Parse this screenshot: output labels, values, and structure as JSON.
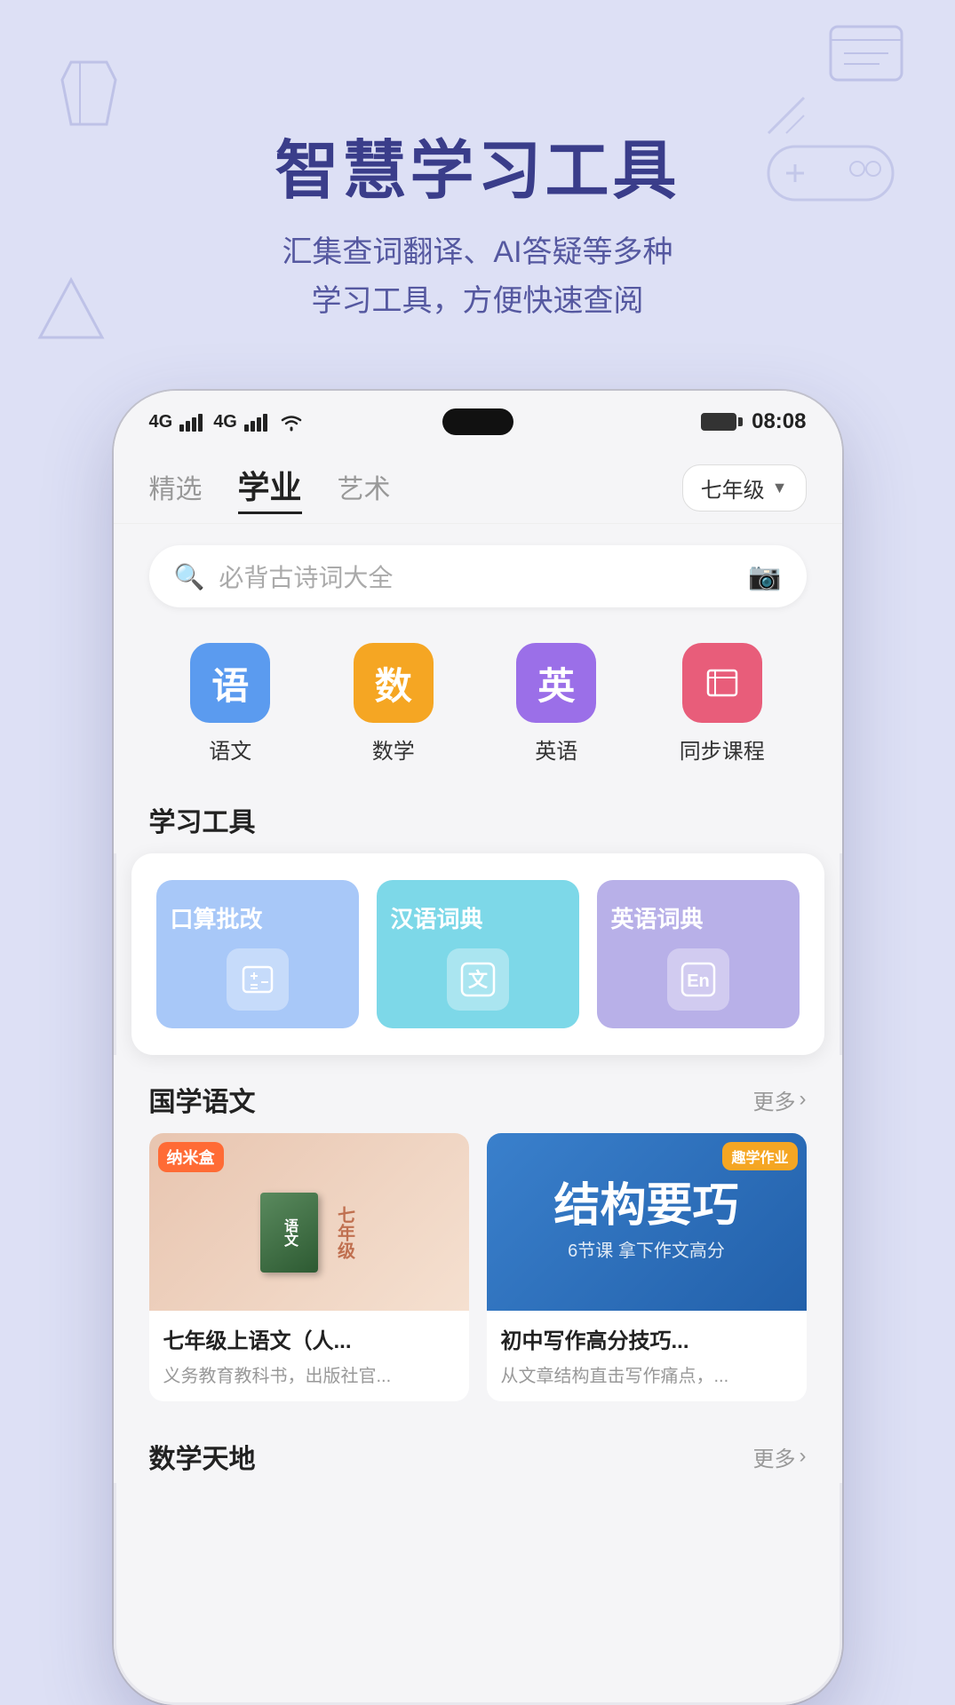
{
  "hero": {
    "title": "智慧学习工具",
    "subtitle_line1": "汇集查词翻译、AI答疑等多种",
    "subtitle_line2": "学习工具，方便快速查阅"
  },
  "status_bar": {
    "signal1": "4G",
    "signal2": "4G",
    "time": "08:08"
  },
  "nav": {
    "tab_curated": "精选",
    "tab_academic": "学业",
    "tab_art": "艺术",
    "grade": "七年级"
  },
  "search": {
    "placeholder": "必背古诗词大全"
  },
  "subjects": [
    {
      "label": "语文",
      "icon_text": "语",
      "color": "chinese"
    },
    {
      "label": "数学",
      "icon_text": "数",
      "color": "math"
    },
    {
      "label": "英语",
      "icon_text": "英",
      "color": "english"
    },
    {
      "label": "同步课程",
      "icon_text": "▪",
      "color": "course"
    }
  ],
  "learning_tools": {
    "section_title": "学习工具",
    "tools": [
      {
        "title": "口算批改",
        "icon": "⊞",
        "color": "oral"
      },
      {
        "title": "汉语词典",
        "icon": "文",
        "color": "chinese-dict"
      },
      {
        "title": "英语词典",
        "icon": "En",
        "color": "english-dict"
      }
    ]
  },
  "guoxue": {
    "section_title": "国学语文",
    "more_label": "更多",
    "cards": [
      {
        "badge": "纳米盒",
        "title": "七年级上语文（人...",
        "desc": "义务教育教科书，出版社官...",
        "book_text": "语文"
      },
      {
        "badge": "趣学作业",
        "headline": "结构要巧",
        "sub": "6节课  拿下作文高分",
        "title": "初中写作高分技巧...",
        "desc": "从文章结构直击写作痛点，..."
      }
    ]
  },
  "math": {
    "section_title": "数学天地",
    "more_label": "更多"
  }
}
